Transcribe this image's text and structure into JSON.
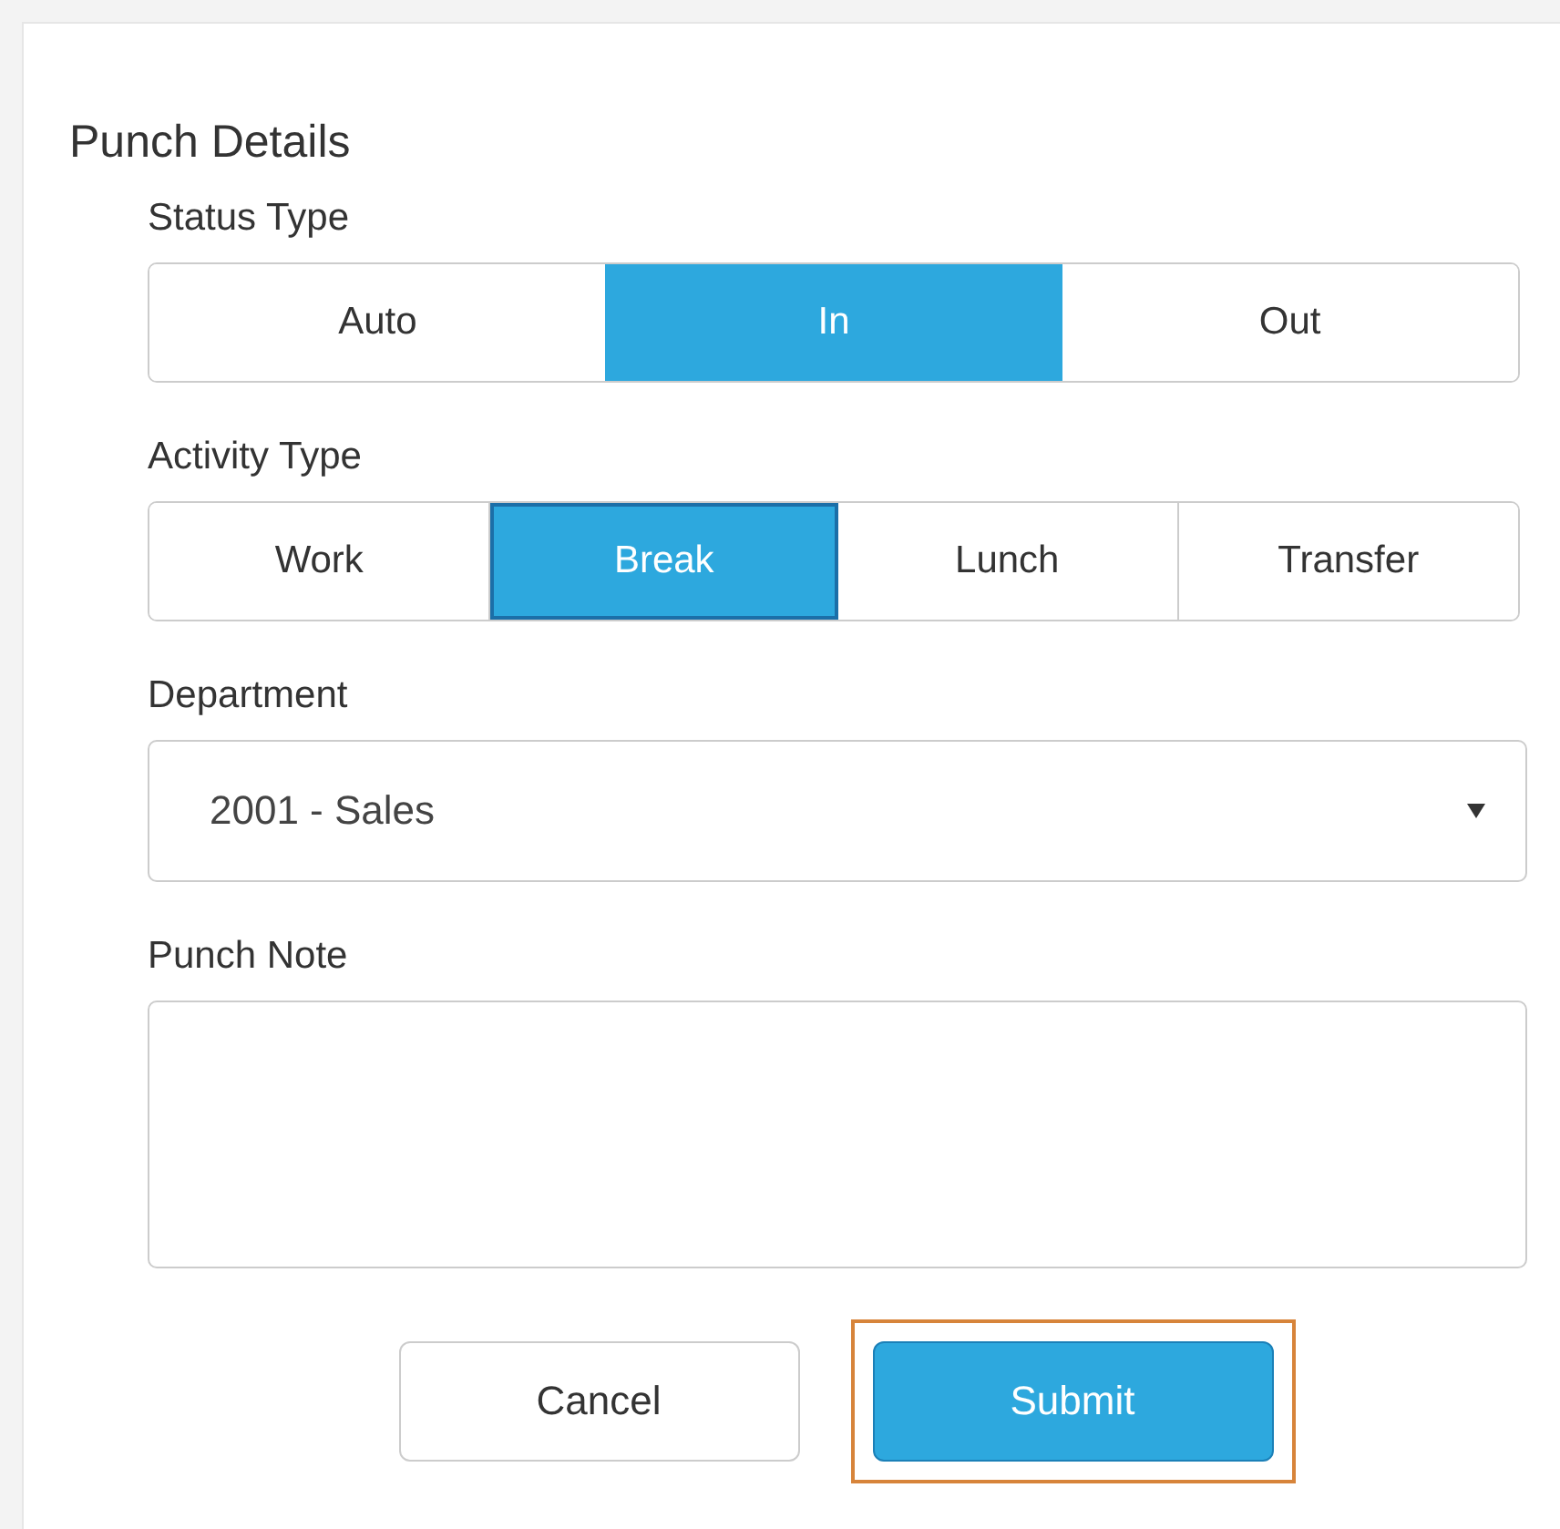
{
  "title": "Punch Details",
  "status_type": {
    "label": "Status Type",
    "options": [
      {
        "label": "Auto",
        "selected": false
      },
      {
        "label": "In",
        "selected": true
      },
      {
        "label": "Out",
        "selected": false
      }
    ]
  },
  "activity_type": {
    "label": "Activity Type",
    "options": [
      {
        "label": "Work",
        "selected": false
      },
      {
        "label": "Break",
        "selected": true
      },
      {
        "label": "Lunch",
        "selected": false
      },
      {
        "label": "Transfer",
        "selected": false
      }
    ]
  },
  "department": {
    "label": "Department",
    "value": "2001 - Sales"
  },
  "punch_note": {
    "label": "Punch Note"
  },
  "buttons": [
    {
      "label": "Cancel",
      "kind": "secondary",
      "highlighted": false
    },
    {
      "label": "Submit",
      "kind": "primary",
      "highlighted": true
    }
  ]
}
